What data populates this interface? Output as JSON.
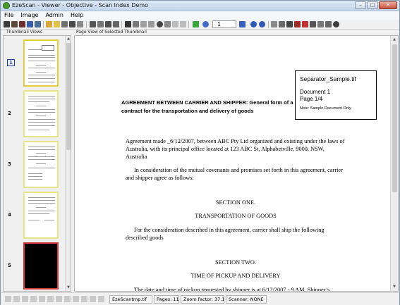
{
  "window": {
    "title": "EzeScan - Viewer - Objective - Scan Index Demo",
    "minimize_glyph": "–",
    "maximize_glyph": "□",
    "close_glyph": "✕"
  },
  "menu": [
    "File",
    "Image",
    "Admin",
    "Help"
  ],
  "toolbar": {
    "page_value": "1",
    "icons": [
      "scan-icon",
      "scan-options-icon",
      "scan-settings-icon",
      "new-icon",
      "open-folder-icon",
      "open-icon",
      "print-icon",
      "delete-icon",
      "barcode-icon",
      "crop-icon",
      "rotate-icon",
      "deskew-icon",
      "contrast-icon",
      "undo-icon",
      "redo-icon",
      "flag-icon",
      "prev-page-icon",
      "next-page-icon",
      "zoom-in-icon",
      "zoom-out-icon",
      "fit-icon",
      "ocr-icon",
      "pen-icon",
      "highlight-icon",
      "stamp-icon",
      "settings-icon"
    ]
  },
  "panels": {
    "thumbnails_label": "Thumbnail Views",
    "page_view_label": "Page View of Selected Thumbnail"
  },
  "thumbnails": [
    {
      "number": "1",
      "current": true,
      "type": "text-page"
    },
    {
      "number": "2",
      "current": false,
      "type": "text-page"
    },
    {
      "number": "3",
      "current": false,
      "type": "text-page"
    },
    {
      "number": "4",
      "current": false,
      "type": "text-page"
    },
    {
      "number": "5",
      "current": false,
      "type": "black-page"
    }
  ],
  "separator": {
    "filename": "Separator_Sample.tif",
    "document": "Document 1",
    "page": "Page 1/4",
    "note": "Note: Sample Document Only"
  },
  "document": {
    "heading": "AGREEMENT BETWEEN CARRIER AND SHIPPER:  General form of a contract for the transportation and delivery of goods",
    "para1": "Agreement made _6/12/2007, between  ABC Pty Ltd  organized and existing under the laws of Australia, with its principal office located at 123 ABC St, Alphabetville, 9000, NSW, Australia",
    "para2": "In consideration of the mutual covenants and promises set forth in this agreement, carrier and shipper agree as follows:",
    "section1": "SECTION ONE.",
    "section1_title": "TRANSPORTATION OF GOODS",
    "para3": "For the consideration described in this agreement, carrier shall ship the following described goods",
    "section2": "SECTION TWO.",
    "section2_title": "TIME OF PICKUP AND DELIVERY",
    "para4": "The date and time of pickup requested by shipper is at 6/12/2007 - 9 AM. Shipper’s"
  },
  "status": {
    "filename": "EzeScantmp.tif",
    "pages": "Pages: 11",
    "zoom": "Zoom factor: 37.11%",
    "scanner": "Scanner: NONE"
  },
  "colors": {
    "thumb_border": "#e8e68a",
    "selected_black_border": "#d23a3a",
    "title_bar": "#c4d6ec"
  }
}
